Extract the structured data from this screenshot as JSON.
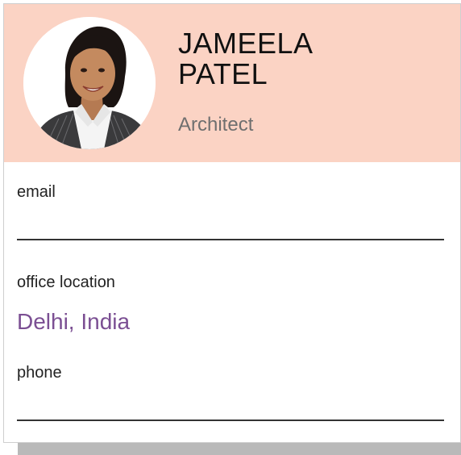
{
  "profile": {
    "first_name": "JAMEELA",
    "last_name": "PATEL",
    "title": "Architect",
    "avatar": "photo of Jameela Patel"
  },
  "fields": {
    "email": {
      "label": "email",
      "value": ""
    },
    "office_location": {
      "label": "office location",
      "value": "Delhi, India"
    },
    "phone": {
      "label": "phone",
      "value": ""
    }
  },
  "colors": {
    "header_bg": "#fbd3c4",
    "accent_text": "#7b4f93",
    "shadow": "#b9b9b9"
  }
}
